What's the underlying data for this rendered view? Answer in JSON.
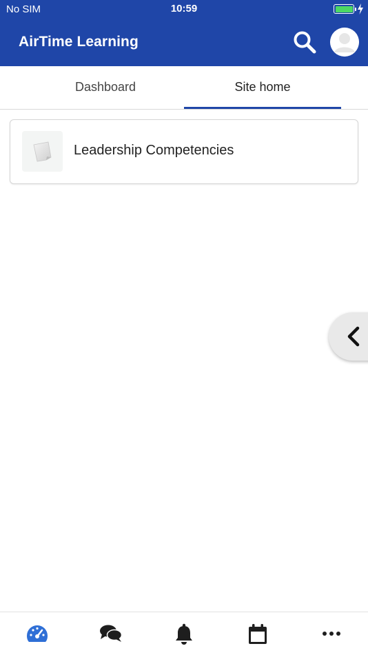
{
  "status_bar": {
    "carrier": "No SIM",
    "time": "10:59",
    "battery_icon": "battery-full-icon",
    "charging_icon": "charging-bolt-icon"
  },
  "header": {
    "title": "AirTime Learning",
    "search_icon": "search-icon",
    "avatar_icon": "user-avatar-icon",
    "background_color": "#1f46a8"
  },
  "tabs": [
    {
      "label": "Dashboard",
      "active": false
    },
    {
      "label": "Site home",
      "active": true
    }
  ],
  "courses": [
    {
      "name": "Leadership Competencies",
      "icon": "course-document-icon"
    }
  ],
  "drawer_handle": {
    "icon": "chevron-left-icon"
  },
  "bottom_nav": [
    {
      "icon": "dashboard-gauge-icon",
      "active": true
    },
    {
      "icon": "messages-icon",
      "active": false
    },
    {
      "icon": "notifications-bell-icon",
      "active": false
    },
    {
      "icon": "calendar-icon",
      "active": false
    },
    {
      "icon": "more-icon",
      "active": false
    }
  ],
  "colors": {
    "accent": "#1f46a8",
    "active_nav": "#2f6fd6",
    "charge": "#4cd964"
  }
}
